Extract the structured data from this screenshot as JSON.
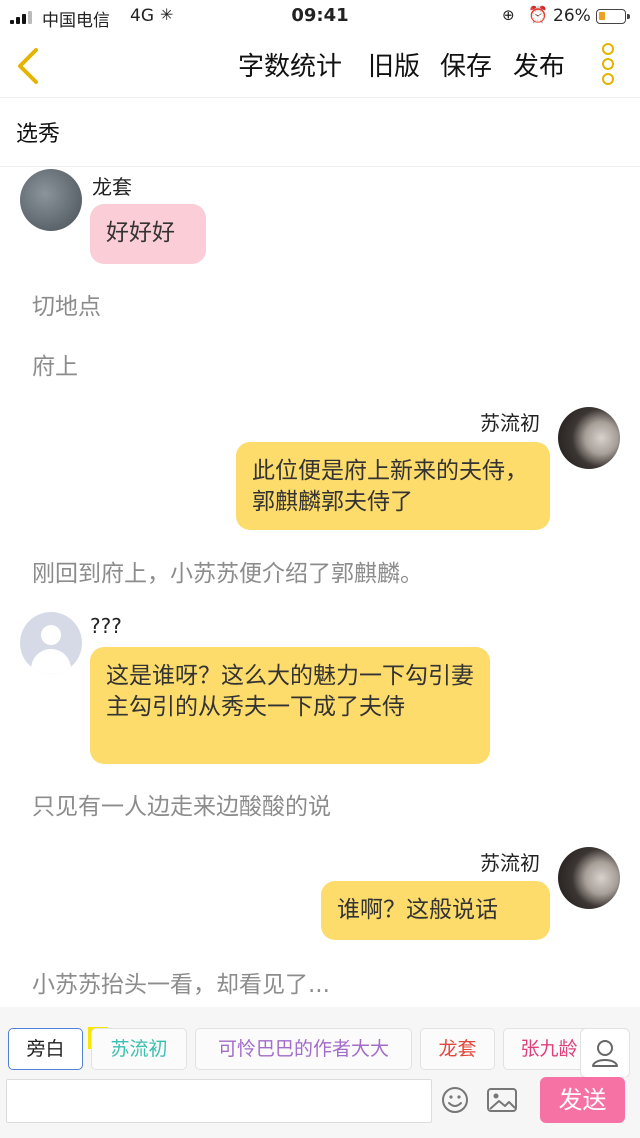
{
  "status_bar": {
    "carrier": "中国电信",
    "network": "4G",
    "time": "09:41",
    "battery_percent_label": "26%",
    "battery_level": 0.26
  },
  "nav": {
    "actions": [
      "字数统计",
      "旧版",
      "保存",
      "发布"
    ]
  },
  "chapter_title": "选秀",
  "messages": [
    {
      "kind": "left",
      "sender": "龙套",
      "text": "好好好",
      "bubble_color": "#fbcdd7"
    },
    {
      "kind": "narration",
      "text": "切地点"
    },
    {
      "kind": "narration",
      "text": "府上"
    },
    {
      "kind": "right",
      "sender": "苏流初",
      "text": "此位便是府上新来的夫侍，郭麒麟郭夫侍了",
      "bubble_color": "#fddc6b"
    },
    {
      "kind": "narration",
      "text": "刚回到府上，小苏苏便介绍了郭麒麟。"
    },
    {
      "kind": "left",
      "sender": "???",
      "text": "这是谁呀？这么大的魅力一下勾引妻主勾引的从秀夫一下成了夫侍",
      "bubble_color": "#fddc6b"
    },
    {
      "kind": "narration",
      "text": "只见有一人边走来边酸酸的说"
    },
    {
      "kind": "right",
      "sender": "苏流初",
      "text": "谁啊？这般说话",
      "bubble_color": "#fddc6b"
    },
    {
      "kind": "narration",
      "text": "小苏苏抬头一看，却看见了..."
    }
  ],
  "roles": [
    {
      "label": "旁白",
      "color": "#222222"
    },
    {
      "label": "苏流初",
      "color": "#3bbfb0"
    },
    {
      "label": "可怜巴巴的作者大大",
      "color": "#a36cc9"
    },
    {
      "label": "龙套",
      "color": "#e0483b"
    },
    {
      "label": "张九龄",
      "color": "#e0407a"
    }
  ],
  "host_tag": "主",
  "composer": {
    "placeholder": "",
    "send_label": "发送"
  },
  "colors": {
    "accent_yellow": "#e5b400",
    "send_pink": "#f772a4",
    "active_role_border": "#4d83d9"
  },
  "icons": [
    "back-chevron-icon",
    "more-dots-icon",
    "person-icon",
    "emoji-icon",
    "image-icon"
  ]
}
